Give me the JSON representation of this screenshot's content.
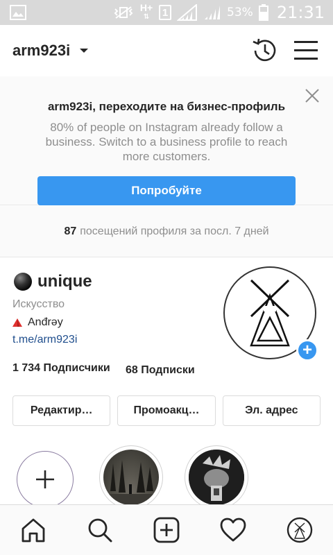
{
  "status_bar": {
    "battery_percent": "53%",
    "time": "21:31",
    "network": "H+",
    "sim": "1",
    "icons": [
      "image-notification-icon",
      "vibrate-icon",
      "network-hplus-icon",
      "sim1-icon",
      "signal-icon",
      "signal-icon",
      "battery-icon"
    ]
  },
  "header": {
    "username": "arm923i",
    "icons": [
      "chevron-down-icon",
      "history-icon",
      "menu-icon"
    ]
  },
  "banner": {
    "title": "arm923i, переходите на бизнес-профиль",
    "description": "80% of people on Instagram already follow a business. Switch to a business profile to reach more customers.",
    "button_label": "Попробуйте",
    "icons": [
      "close-icon"
    ]
  },
  "visits": {
    "count": "87",
    "text": "посещений профиля за посл. 7 дней"
  },
  "profile": {
    "display_name": "unique",
    "category": "Искусство",
    "bio": "Anđrəy",
    "link": "t.me/arm923i",
    "followers": "1 734 Подписчики",
    "following": "68 Подписки",
    "actions": [
      "Редактир…",
      "Промоакц…",
      "Эл. адрес"
    ]
  },
  "highlights": {
    "new_icon": "plus-icon"
  },
  "bottom_nav": {
    "items": [
      "home-icon",
      "search-icon",
      "add-post-icon",
      "activity-heart-icon",
      "profile-avatar-icon"
    ]
  },
  "colors": {
    "accent": "#3897f0",
    "link": "#1e4d8c",
    "muted_text": "#8e8e8e",
    "status_bar_bg": "#d9d9d9"
  }
}
